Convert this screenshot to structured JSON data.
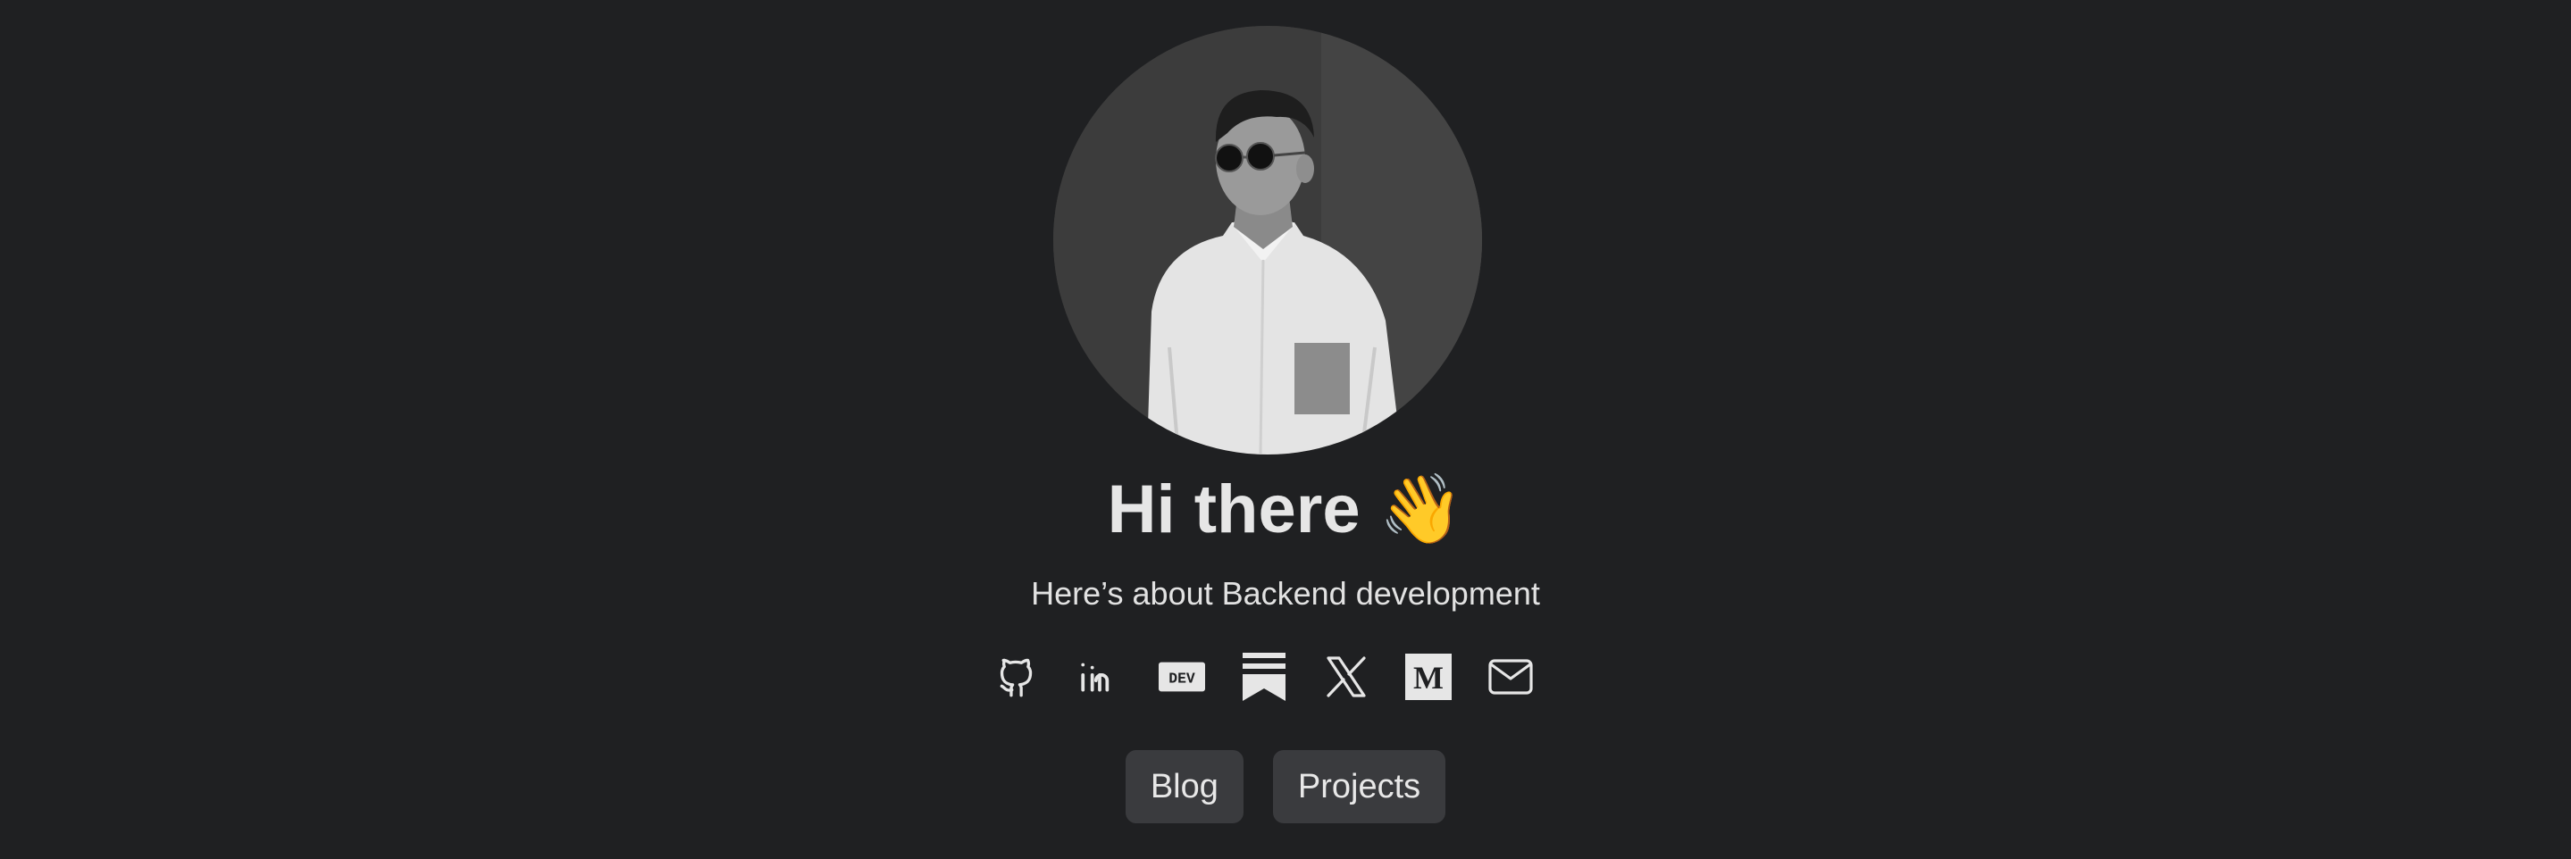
{
  "profile": {
    "greeting": "Hi there",
    "greeting_emoji": "👋",
    "subtitle": "Here’s about Backend development"
  },
  "social_links": [
    {
      "icon": "github-icon"
    },
    {
      "icon": "linkedin-icon"
    },
    {
      "icon": "dev-icon",
      "label": "DEV"
    },
    {
      "icon": "substack-icon"
    },
    {
      "icon": "x-icon"
    },
    {
      "icon": "medium-icon",
      "label": "M"
    },
    {
      "icon": "mail-icon"
    }
  ],
  "nav": {
    "blog_label": "Blog",
    "projects_label": "Projects"
  },
  "colors": {
    "background": "#1f2022",
    "text": "#e8e8e8",
    "button_background": "#3a3b3e"
  }
}
